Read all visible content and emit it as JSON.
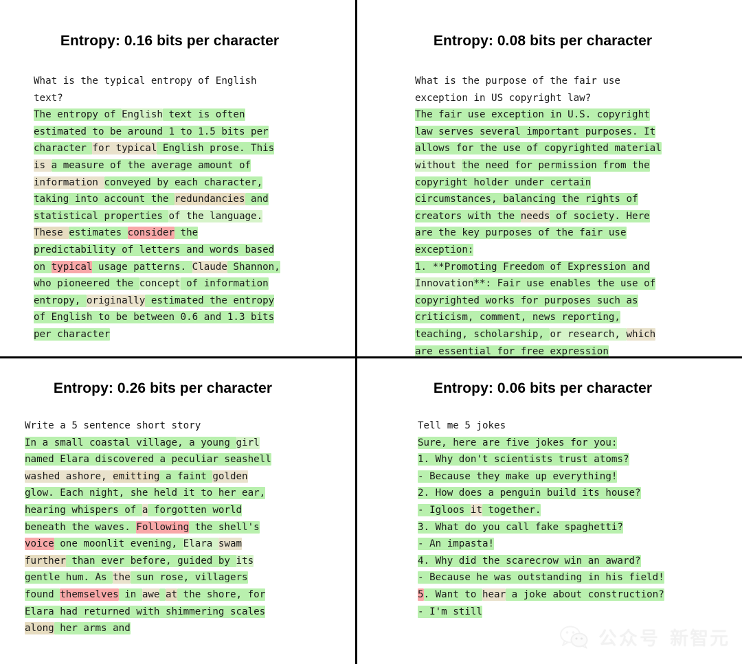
{
  "figure": {
    "background": "#ffffff",
    "divider_color": "#000000",
    "layout": "2x2-grid"
  },
  "colors": {
    "high_prob_green": "#b9f0ae",
    "mid_tan": "#e6dcc0",
    "low_prob_pink": "#f8a8a8",
    "text": "#1a1a1a",
    "title": "#000000"
  },
  "panels": [
    {
      "id": "top-left",
      "title": "Entropy: 0.16 bits per character",
      "entropy": 0.16,
      "prompt": "What is the typical entropy of English text?",
      "completion": "The entropy of English text is often estimated to be around 1 to 1.5 bits per character for typical English prose. This is a measure of the average amount of information conveyed by each character, taking into account the redundancies and statistical properties of the language. These estimates consider the predictability of letters and words based on typical usage patterns. Claude Shannon, who pioneered the concept of information entropy, originally estimated the entropy of English to be between 0.6 and 1.3 bits per character",
      "lines": [
        [
          {
            "t": "What is the typical entropy of English",
            "c": "none"
          }
        ],
        [
          {
            "t": "text?",
            "c": "none"
          }
        ],
        [
          {
            "t": "The entropy of ",
            "c": "g1"
          },
          {
            "t": "English",
            "c": "g2"
          },
          {
            "t": " text is often",
            "c": "g1"
          }
        ],
        [
          {
            "t": "estimated to be around 1 to 1.5 bits per",
            "c": "g1"
          }
        ],
        [
          {
            "t": "character ",
            "c": "g1"
          },
          {
            "t": "for typical",
            "c": "tan1"
          },
          {
            "t": " English prose. This",
            "c": "g1"
          }
        ],
        [
          {
            "t": "is ",
            "c": "tan1"
          },
          {
            "t": "a measure of the average amount of",
            "c": "g1"
          }
        ],
        [
          {
            "t": "information ",
            "c": "tan1"
          },
          {
            "t": "conveyed by each character,",
            "c": "g1"
          }
        ],
        [
          {
            "t": "taking into account the ",
            "c": "g1"
          },
          {
            "t": "redundancies",
            "c": "tan2"
          },
          {
            "t": " and",
            "c": "g1"
          }
        ],
        [
          {
            "t": "statistical properties ",
            "c": "g1"
          },
          {
            "t": "of the language.",
            "c": "g2"
          }
        ],
        [
          {
            "t": "These ",
            "c": "tan2"
          },
          {
            "t": "estimates ",
            "c": "g1"
          },
          {
            "t": "consider",
            "c": "pink1"
          },
          {
            "t": " the",
            "c": "g1"
          }
        ],
        [
          {
            "t": "predictability of letters and words based",
            "c": "g1"
          }
        ],
        [
          {
            "t": "on ",
            "c": "g1"
          },
          {
            "t": "typical",
            "c": "pink1"
          },
          {
            "t": " usage patterns. ",
            "c": "g1"
          },
          {
            "t": "Claude",
            "c": "tan1"
          },
          {
            "t": " Shannon,",
            "c": "g1"
          }
        ],
        [
          {
            "t": "who pioneered the ",
            "c": "g1"
          },
          {
            "t": "concept",
            "c": "g2"
          },
          {
            "t": " of information",
            "c": "g1"
          }
        ],
        [
          {
            "t": "entropy, ",
            "c": "g1"
          },
          {
            "t": "originally",
            "c": "tan1"
          },
          {
            "t": " estimated the entropy",
            "c": "g1"
          }
        ],
        [
          {
            "t": "of English to be between 0.6 and 1.3 bits",
            "c": "g1"
          }
        ],
        [
          {
            "t": "per character",
            "c": "g1"
          }
        ]
      ]
    },
    {
      "id": "top-right",
      "title": "Entropy: 0.08 bits per character",
      "entropy": 0.08,
      "prompt": "What is the purpose of the fair use exception in US copyright law?",
      "completion": "The fair use exception in U.S. copyright law serves several important purposes. It allows for the use of copyrighted material without the need for permission from the copyright holder under certain circumstances, balancing the rights of creators with the needs of society. Here are the key purposes of the fair use exception: 1. **Promoting Freedom of Expression and Innovation**: Fair use enables the use of copyrighted works for purposes such as criticism, comment, news reporting, teaching, scholarship, or research, which are essential for free expression",
      "lines": [
        [
          {
            "t": "What is the purpose of the fair use",
            "c": "none"
          }
        ],
        [
          {
            "t": "exception in US copyright law?",
            "c": "none"
          }
        ],
        [
          {
            "t": "The fair use exception in U.S. copyright",
            "c": "g1"
          }
        ],
        [
          {
            "t": "law serves several important purposes. It",
            "c": "g1"
          }
        ],
        [
          {
            "t": "allows for the use of copyrighted material",
            "c": "g1"
          }
        ],
        [
          {
            "t": "without ",
            "c": "g2"
          },
          {
            "t": "the need for permission from the",
            "c": "g1"
          }
        ],
        [
          {
            "t": "copyright holder under certain",
            "c": "g1"
          }
        ],
        [
          {
            "t": "circumstances, balancing the rights of",
            "c": "g1"
          }
        ],
        [
          {
            "t": "creators with the ",
            "c": "g1"
          },
          {
            "t": "needs",
            "c": "tan1"
          },
          {
            "t": " of society. Here",
            "c": "g1"
          }
        ],
        [
          {
            "t": "are the key purposes of the fair use",
            "c": "g1"
          }
        ],
        [
          {
            "t": "exception:",
            "c": "g1"
          }
        ],
        [
          {
            "t": "1. **Promoting Freedom of Expression and",
            "c": "g1"
          }
        ],
        [
          {
            "t": "Innovation",
            "c": "g2"
          },
          {
            "t": "**: Fair use enables the use of",
            "c": "g1"
          }
        ],
        [
          {
            "t": "copyrighted works for purposes such as",
            "c": "g1"
          }
        ],
        [
          {
            "t": "criticism, comment, news reporting,",
            "c": "g1"
          }
        ],
        [
          {
            "t": "teaching, scholarship, ",
            "c": "g1"
          },
          {
            "t": "or research, ",
            "c": "g2"
          },
          {
            "t": "which",
            "c": "tan1"
          }
        ],
        [
          {
            "t": "are essential for free expression",
            "c": "g1"
          }
        ]
      ]
    },
    {
      "id": "bottom-left",
      "title": "Entropy: 0.26 bits per character",
      "entropy": 0.26,
      "prompt": "Write a 5 sentence short story",
      "completion": "In a small coastal village, a young girl named Elara discovered a peculiar seashell washed ashore, emitting a faint golden glow. Each night, she held it to her ear, hearing whispers of a forgotten world beneath the waves. Following the shell's voice one moonlit evening, Elara swam further than ever before, guided by its gentle hum. As the sun rose, villagers found themselves in awe at the shore, for Elara had returned with shimmering scales along her arms and",
      "lines": [
        [
          {
            "t": "Write a 5 sentence short story",
            "c": "none"
          }
        ],
        [
          {
            "t": "In a small coastal village, a young ",
            "c": "g1"
          },
          {
            "t": "girl",
            "c": "g2"
          }
        ],
        [
          {
            "t": "named Elara discovered a peculiar seashell",
            "c": "g1"
          }
        ],
        [
          {
            "t": "washed ashore, ",
            "c": "tan1"
          },
          {
            "t": "emitting",
            "c": "tan2"
          },
          {
            "t": " a faint ",
            "c": "g1"
          },
          {
            "t": "golden",
            "c": "tan1"
          }
        ],
        [
          {
            "t": "glow. Each night, she held it to her ear,",
            "c": "g1"
          }
        ],
        [
          {
            "t": "hearing whispers of ",
            "c": "g1"
          },
          {
            "t": "a",
            "c": "tan1"
          },
          {
            "t": " forgotten world",
            "c": "g1"
          }
        ],
        [
          {
            "t": "beneath the waves. ",
            "c": "g1"
          },
          {
            "t": "Following",
            "c": "pink1"
          },
          {
            "t": " the shell's",
            "c": "g1"
          }
        ],
        [
          {
            "t": "voice",
            "c": "pink1"
          },
          {
            "t": " one moonlit evening, ",
            "c": "g1"
          },
          {
            "t": "Elara ",
            "c": "g2"
          },
          {
            "t": "swam",
            "c": "tan1"
          }
        ],
        [
          {
            "t": "further",
            "c": "tan2"
          },
          {
            "t": " than ever before, guided by ",
            "c": "g1"
          },
          {
            "t": "its",
            "c": "g2"
          }
        ],
        [
          {
            "t": "gentle hum. As ",
            "c": "g1"
          },
          {
            "t": "the",
            "c": "tan1"
          },
          {
            "t": " sun rose, villagers",
            "c": "g1"
          }
        ],
        [
          {
            "t": "found ",
            "c": "g1"
          },
          {
            "t": "themselves",
            "c": "pink1"
          },
          {
            "t": " in ",
            "c": "g1"
          },
          {
            "t": "awe",
            "c": "tan1"
          },
          {
            "t": " ",
            "c": "g1"
          },
          {
            "t": "at",
            "c": "tan2"
          },
          {
            "t": " the shore, for",
            "c": "g1"
          }
        ],
        [
          {
            "t": "Elara had returned with shimmering scales",
            "c": "g1"
          }
        ],
        [
          {
            "t": "along",
            "c": "tan2"
          },
          {
            "t": " her arms and",
            "c": "g1"
          }
        ]
      ]
    },
    {
      "id": "bottom-right",
      "title": "Entropy: 0.06 bits per character",
      "entropy": 0.06,
      "prompt": "Tell me 5 jokes",
      "completion": "Sure, here are five jokes for you: 1. Why don't scientists trust atoms? - Because they make up everything! 2. How does a penguin build its house? - Igloos it together. 3. What do you call fake spaghetti? - An impasta! 4. Why did the scarecrow win an award? - Because he was outstanding in his field! 5. Want to hear a joke about construction? - I'm still",
      "lines": [
        [
          {
            "t": "Tell me 5 jokes",
            "c": "none"
          }
        ],
        [
          {
            "t": "Sure, here are five jokes for you:",
            "c": "g1"
          }
        ],
        [
          {
            "t": "1. Why don't scientists trust atoms?",
            "c": "g1"
          }
        ],
        [
          {
            "t": "- Because they make up everything!",
            "c": "g1"
          }
        ],
        [
          {
            "t": "2. How does a penguin build its house?",
            "c": "g1"
          }
        ],
        [
          {
            "t": "- Igloos ",
            "c": "g1"
          },
          {
            "t": "it",
            "c": "tan1"
          },
          {
            "t": " together.",
            "c": "g1"
          }
        ],
        [
          {
            "t": "3. What do you call fake spaghetti?",
            "c": "g1"
          }
        ],
        [
          {
            "t": "- An impasta!",
            "c": "g1"
          }
        ],
        [
          {
            "t": "4. Why did the scarecrow win an award?",
            "c": "g1"
          }
        ],
        [
          {
            "t": "- Because he was outstanding in his field!",
            "c": "g1"
          }
        ],
        [
          {
            "t": "5",
            "c": "pink1"
          },
          {
            "t": ". Want to ",
            "c": "g1"
          },
          {
            "t": "hear",
            "c": "tan1"
          },
          {
            "t": " a joke about construction?",
            "c": "g1"
          }
        ],
        [
          {
            "t": "- I'm still",
            "c": "g1"
          }
        ]
      ]
    }
  ],
  "watermark": {
    "icon": "wechat-icon",
    "label_1": "公众号",
    "label_2": "新智元",
    "color": "#f2f2f2"
  }
}
